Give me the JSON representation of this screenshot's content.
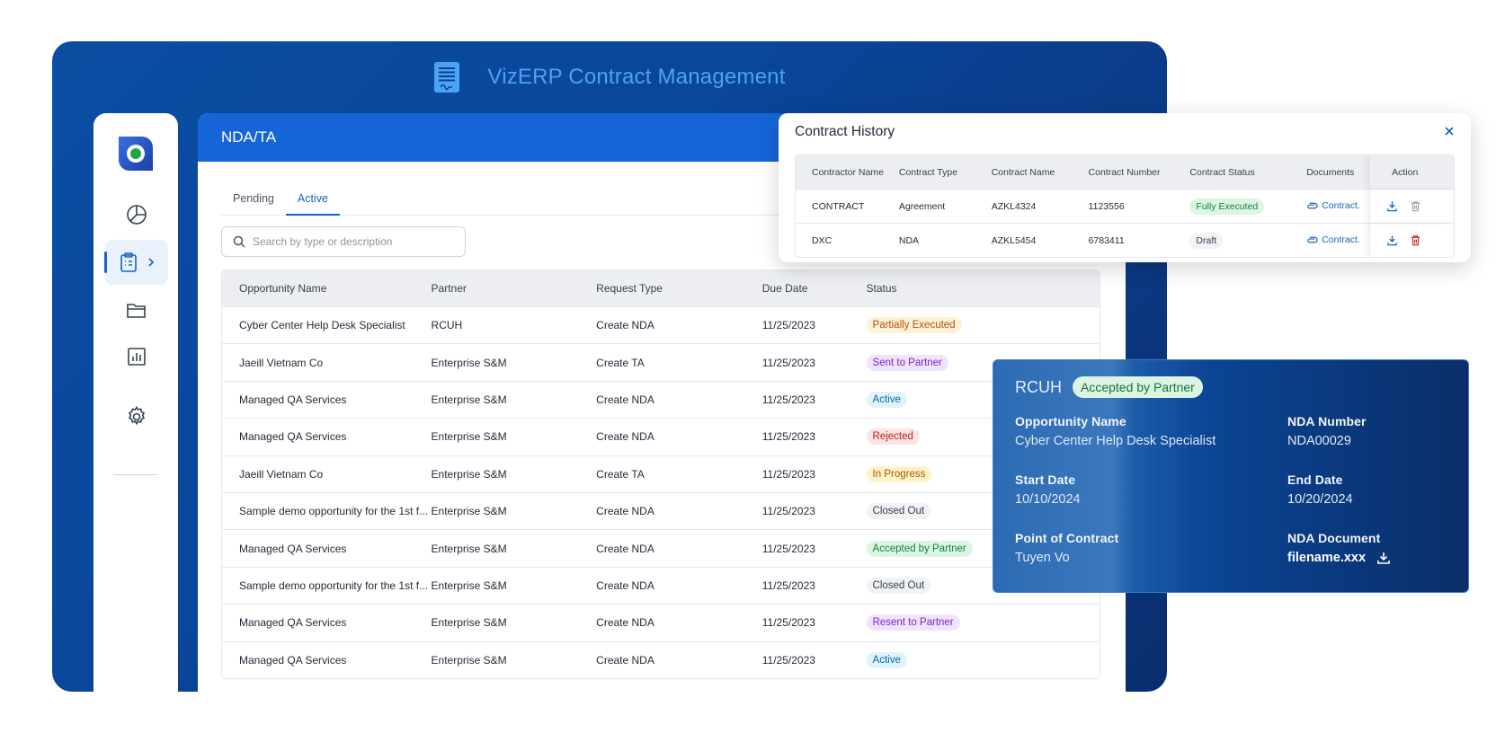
{
  "app": {
    "title": "VizERP Contract Management"
  },
  "sidebar": {
    "items": [
      {
        "name": "dashboard",
        "icon": "pie-chart-icon"
      },
      {
        "name": "contracts",
        "icon": "clipboard-icon",
        "active": true
      },
      {
        "name": "files",
        "icon": "folder-icon"
      },
      {
        "name": "reports",
        "icon": "bar-chart-icon"
      },
      {
        "name": "settings",
        "icon": "gear-icon"
      }
    ]
  },
  "main": {
    "title": "NDA/TA",
    "tabs": [
      {
        "label": "Pending"
      },
      {
        "label": "Active",
        "active": true
      }
    ],
    "search_placeholder": "Search by type or description",
    "columns": [
      "Opportunity Name",
      "Partner",
      "Request Type",
      "Due Date",
      "Status"
    ],
    "rows": [
      {
        "opportunity": "Cyber Center Help Desk Specialist",
        "partner": "RCUH",
        "request_type": "Create NDA",
        "due": "11/25/2023",
        "status": "Partially Executed"
      },
      {
        "opportunity": "Jaeill Vietnam Co",
        "partner": "Enterprise S&M",
        "request_type": "Create TA",
        "due": "11/25/2023",
        "status": "Sent to Partner"
      },
      {
        "opportunity": "Managed QA Services",
        "partner": "Enterprise S&M",
        "request_type": "Create NDA",
        "due": "11/25/2023",
        "status": "Active"
      },
      {
        "opportunity": "Managed QA Services",
        "partner": "Enterprise S&M",
        "request_type": "Create NDA",
        "due": "11/25/2023",
        "status": "Rejected"
      },
      {
        "opportunity": "Jaeill Vietnam Co",
        "partner": "Enterprise S&M",
        "request_type": "Create TA",
        "due": "11/25/2023",
        "status": "In Progress"
      },
      {
        "opportunity": "Sample demo opportunity for the 1st f...",
        "partner": "Enterprise S&M",
        "request_type": "Create NDA",
        "due": "11/25/2023",
        "status": "Closed Out"
      },
      {
        "opportunity": "Managed QA Services",
        "partner": "Enterprise S&M",
        "request_type": "Create NDA",
        "due": "11/25/2023",
        "status": "Accepted by Partner"
      },
      {
        "opportunity": "Sample demo opportunity for the 1st f...",
        "partner": "Enterprise S&M",
        "request_type": "Create NDA",
        "due": "11/25/2023",
        "status": "Closed Out"
      },
      {
        "opportunity": "Managed QA Services",
        "partner": "Enterprise S&M",
        "request_type": "Create NDA",
        "due": "11/25/2023",
        "status": "Resent to Partner"
      },
      {
        "opportunity": "Managed QA Services",
        "partner": "Enterprise S&M",
        "request_type": "Create NDA",
        "due": "11/25/2023",
        "status": "Active"
      }
    ]
  },
  "status_colors": {
    "Partially Executed": {
      "bg": "#fdf1d6",
      "fg": "#b45309"
    },
    "Sent to Partner": {
      "bg": "#efe4fb",
      "fg": "#7e22ce"
    },
    "Active": {
      "bg": "#e0f3fb",
      "fg": "#0369a1"
    },
    "Rejected": {
      "bg": "#fde3e3",
      "fg": "#b91c1c"
    },
    "In Progress": {
      "bg": "#fef3c7",
      "fg": "#b45309"
    },
    "Closed Out": {
      "bg": "#f1f2f4",
      "fg": "#374151"
    },
    "Accepted by Partner": {
      "bg": "#dcf5e3",
      "fg": "#15803d"
    },
    "Resent to Partner": {
      "bg": "#efe4fb",
      "fg": "#7e22ce"
    },
    "Fully Executed": {
      "bg": "#dcf5e3",
      "fg": "#15803d"
    },
    "Draft": {
      "bg": "#f1f2f4",
      "fg": "#374151"
    }
  },
  "history": {
    "title": "Contract History",
    "columns": [
      "Contractor Name",
      "Contract Type",
      "Contract Name",
      "Contract Number",
      "Contract Status",
      "Documents",
      "Action"
    ],
    "rows": [
      {
        "contractor": "CONTRACT",
        "type": "Agreement",
        "name": "AZKL4324",
        "number": "1123556",
        "status": "Fully Executed",
        "document": "Contract.",
        "delete_enabled": false
      },
      {
        "contractor": "DXC",
        "type": "NDA",
        "name": "AZKL5454",
        "number": "6783411",
        "status": "Draft",
        "document": "Contract.",
        "delete_enabled": true
      }
    ]
  },
  "detail": {
    "partner": "RCUH",
    "status": "Accepted by Partner",
    "opportunity_label": "Opportunity Name",
    "opportunity_value": "Cyber Center Help Desk Specialist",
    "nda_number_label": "NDA Number",
    "nda_number_value": "NDA00029",
    "start_label": "Start Date",
    "start_value": "10/10/2024",
    "end_label": "End Date",
    "end_value": "10/20/2024",
    "poc_label": "Point of Contract",
    "poc_value": "Tuyen Vo",
    "doc_label": "NDA Document",
    "doc_value": "filename.xxx"
  }
}
